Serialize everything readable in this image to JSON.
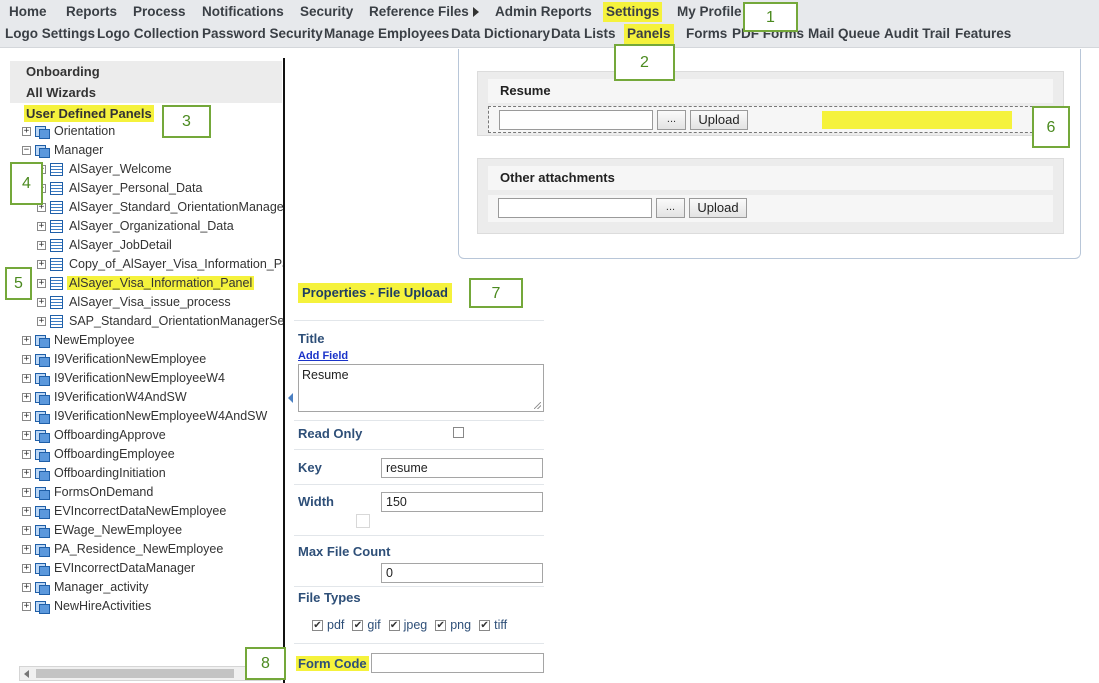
{
  "nav": {
    "main": [
      {
        "label": "Home"
      },
      {
        "label": "Reports"
      },
      {
        "label": "Process"
      },
      {
        "label": "Notifications"
      },
      {
        "label": "Security"
      },
      {
        "label": "Reference Files"
      },
      {
        "label": "Admin Reports"
      },
      {
        "label": "Settings",
        "active": true
      },
      {
        "label": "My Profile"
      }
    ],
    "sub": [
      {
        "label": "Logo Settings"
      },
      {
        "label": "Logo Collection"
      },
      {
        "label": "Password Security"
      },
      {
        "label": "Manage Employees"
      },
      {
        "label": "Data Dictionary"
      },
      {
        "label": "Data Lists"
      },
      {
        "label": "Panels",
        "active": true
      },
      {
        "label": "Forms"
      },
      {
        "label": "PDF Forms"
      },
      {
        "label": "Mail Queue"
      },
      {
        "label": "Audit Trail"
      },
      {
        "label": "Features"
      }
    ]
  },
  "callouts": [
    "1",
    "2",
    "3",
    "4",
    "5",
    "6",
    "7",
    "8"
  ],
  "sidebar": {
    "sections": [
      "Onboarding",
      "All Wizards",
      "User Defined Panels"
    ],
    "tree": [
      {
        "label": "Orientation",
        "toggle": "+",
        "icon": "folder",
        "level": 0
      },
      {
        "label": "Manager",
        "toggle": "−",
        "icon": "folder",
        "level": 0
      },
      {
        "label": "AlSayer_Welcome",
        "toggle": "+",
        "icon": "doc",
        "level": 1
      },
      {
        "label": "AlSayer_Personal_Data",
        "toggle": "+",
        "icon": "doc",
        "level": 1
      },
      {
        "label": "AlSayer_Standard_OrientationManager",
        "toggle": "+",
        "icon": "doc",
        "level": 1
      },
      {
        "label": "AlSayer_Organizational_Data",
        "toggle": "+",
        "icon": "doc",
        "level": 1
      },
      {
        "label": "AlSayer_JobDetail",
        "toggle": "+",
        "icon": "doc",
        "level": 1
      },
      {
        "label": "Copy_of_AlSayer_Visa_Information_Panel",
        "toggle": "+",
        "icon": "doc",
        "level": 1
      },
      {
        "label": "AlSayer_Visa_Information_Panel",
        "toggle": "+",
        "icon": "doc",
        "level": 1,
        "selected": true
      },
      {
        "label": "AlSayer_Visa_issue_process",
        "toggle": "+",
        "icon": "doc",
        "level": 1
      },
      {
        "label": "SAP_Standard_OrientationManagerService",
        "toggle": "+",
        "icon": "doc",
        "level": 1
      },
      {
        "label": "NewEmployee",
        "toggle": "+",
        "icon": "folder",
        "level": 0
      },
      {
        "label": "I9VerificationNewEmployee",
        "toggle": "+",
        "icon": "folder",
        "level": 0
      },
      {
        "label": "I9VerificationNewEmployeeW4",
        "toggle": "+",
        "icon": "folder",
        "level": 0
      },
      {
        "label": "I9VerificationW4AndSW",
        "toggle": "+",
        "icon": "folder",
        "level": 0
      },
      {
        "label": "I9VerificationNewEmployeeW4AndSW",
        "toggle": "+",
        "icon": "folder",
        "level": 0
      },
      {
        "label": "OffboardingApprove",
        "toggle": "+",
        "icon": "folder",
        "level": 0
      },
      {
        "label": "OffboardingEmployee",
        "toggle": "+",
        "icon": "folder",
        "level": 0
      },
      {
        "label": "OffboardingInitiation",
        "toggle": "+",
        "icon": "folder",
        "level": 0
      },
      {
        "label": "FormsOnDemand",
        "toggle": "+",
        "icon": "folder",
        "level": 0
      },
      {
        "label": "EVIncorrectDataNewEmployee",
        "toggle": "+",
        "icon": "folder",
        "level": 0
      },
      {
        "label": "EWage_NewEmployee",
        "toggle": "+",
        "icon": "folder",
        "level": 0
      },
      {
        "label": "PA_Residence_NewEmployee",
        "toggle": "+",
        "icon": "folder",
        "level": 0
      },
      {
        "label": "EVIncorrectDataManager",
        "toggle": "+",
        "icon": "folder",
        "level": 0
      },
      {
        "label": "Manager_activity",
        "toggle": "+",
        "icon": "folder",
        "level": 0
      },
      {
        "label": "NewHireActivities",
        "toggle": "+",
        "icon": "folder",
        "level": 0
      }
    ]
  },
  "preview": {
    "sections": [
      {
        "title": "Resume",
        "browse_label": "...",
        "upload_label": "Upload",
        "selected": true
      },
      {
        "title": "Other attachments",
        "browse_label": "...",
        "upload_label": "Upload",
        "selected": false
      }
    ]
  },
  "props": {
    "title": "Properties - File Upload",
    "title_label": "Title",
    "add_field": "Add Field",
    "title_value": "Resume",
    "read_only_label": "Read Only",
    "read_only_checked": false,
    "key_label": "Key",
    "key_value": "resume",
    "width_label": "Width",
    "width_value": "150",
    "max_file_count_label": "Max File Count",
    "max_file_count_value": "0",
    "file_types_label": "File Types",
    "file_types": [
      {
        "label": "pdf",
        "checked": true
      },
      {
        "label": "gif",
        "checked": true
      },
      {
        "label": "jpeg",
        "checked": true
      },
      {
        "label": "png",
        "checked": true
      },
      {
        "label": "tiff",
        "checked": true
      }
    ],
    "form_code_label": "Form Code",
    "form_code_value": ""
  },
  "colors": {
    "highlight": "#f5f23c",
    "callout_border": "#74a83a",
    "label_blue": "#2e4f78",
    "link_blue": "#1a33c9",
    "nav_bg": "#e7e9ec"
  }
}
